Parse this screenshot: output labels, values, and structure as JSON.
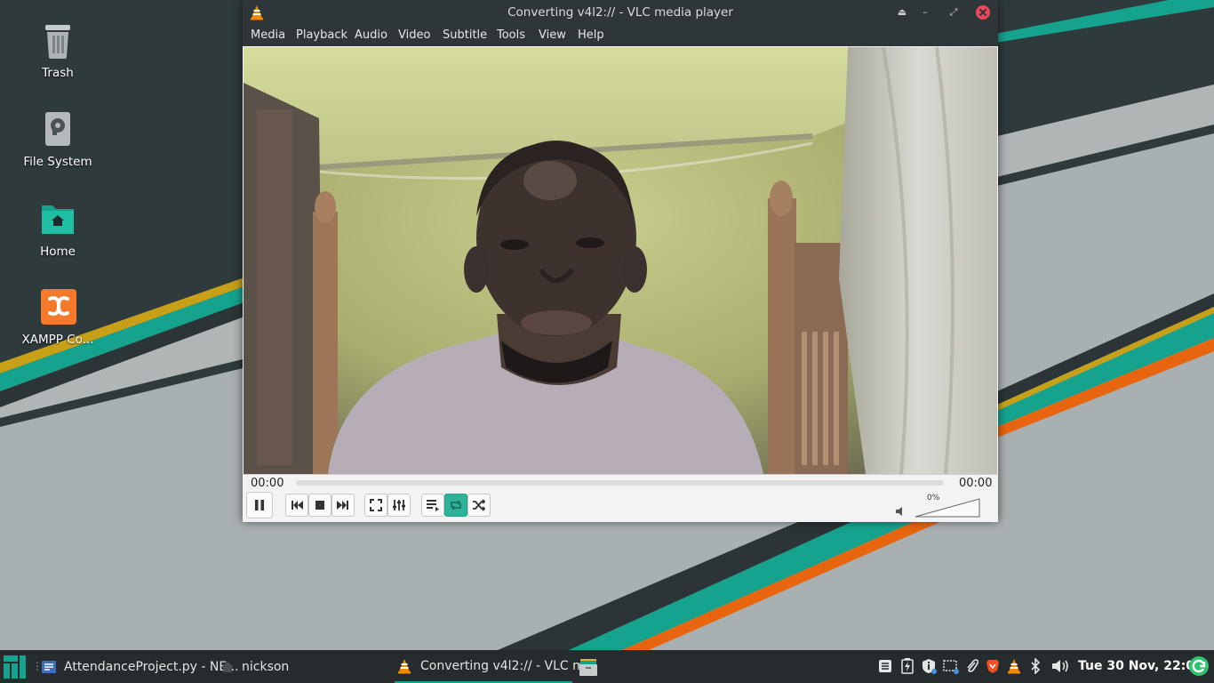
{
  "desktop": {
    "icons": [
      {
        "label": "Trash",
        "icon": "trash-icon"
      },
      {
        "label": "File System",
        "icon": "drive-icon"
      },
      {
        "label": "Home",
        "icon": "home-folder-icon"
      },
      {
        "label": "XAMPP Co...",
        "icon": "xampp-icon"
      }
    ]
  },
  "vlc": {
    "title": "Converting v4l2:// - VLC media player",
    "menu": [
      "Media",
      "Playback",
      "Audio",
      "Video",
      "Subtitle",
      "Tools",
      "View",
      "Help"
    ],
    "time_elapsed": "00:00",
    "time_total": "00:00",
    "volume_label": "0%",
    "volume_level": 0,
    "seek_progress": 0,
    "accent_color": "#2eb398"
  },
  "taskbar": {
    "tasks": [
      {
        "label": "AttendanceProject.py - NE...",
        "icon": "editor-icon"
      },
      {
        "label": "nickson",
        "icon": "home-icon"
      },
      {
        "label": "Converting v4l2:// - VLC m...",
        "icon": "vlc-icon"
      }
    ],
    "clock": "Tue 30 Nov, 22:08",
    "tray": [
      "notes-icon",
      "battery-icon",
      "info-shield-icon",
      "screenshot-icon",
      "paperclip-icon",
      "brave-icon",
      "vlc-icon",
      "bluetooth-icon",
      "volume-icon",
      "update-icon"
    ]
  },
  "colors": {
    "taskbar_bg": "#262b2e",
    "titlebar_bg": "#2f3639",
    "teal": "#16a38d",
    "orange": "#e8650f",
    "yellow": "#c7a018"
  }
}
